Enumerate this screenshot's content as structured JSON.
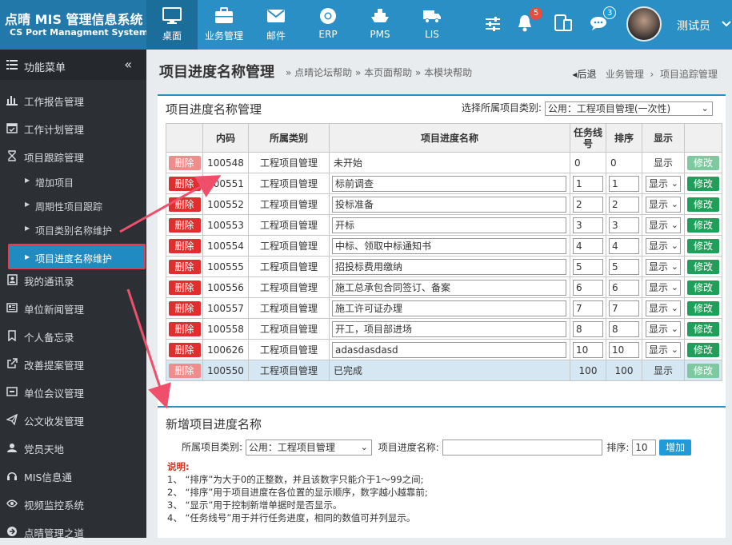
{
  "app": {
    "title": "点晴 MIS 管理信息系统",
    "subtitle": "CS Port Managment System"
  },
  "topnav": [
    {
      "label": "桌面",
      "icon": "monitor-icon",
      "active": true
    },
    {
      "label": "业务管理",
      "icon": "briefcase-icon"
    },
    {
      "label": "邮件",
      "icon": "mail-icon"
    },
    {
      "label": "ERP",
      "icon": "chrome-icon"
    },
    {
      "label": "PMS",
      "icon": "ship-icon"
    },
    {
      "label": "LIS",
      "icon": "truck-icon"
    }
  ],
  "header": {
    "notifications_count": "5",
    "messages_count": "3",
    "user_name": "测试员"
  },
  "sidebar": {
    "title": "功能菜单",
    "items": [
      {
        "label": "工作报告管理",
        "icon": "bar-chart-icon"
      },
      {
        "label": "工作计划管理",
        "icon": "calendar-check-icon"
      },
      {
        "label": "项目跟踪管理",
        "icon": "hourglass-icon"
      },
      {
        "label": "我的通讯录",
        "icon": "address-book-icon"
      },
      {
        "label": "单位新闻管理",
        "icon": "newspaper-icon"
      },
      {
        "label": "个人备忘录",
        "icon": "bookmark-icon"
      },
      {
        "label": "改善提案管理",
        "icon": "external-link-icon"
      },
      {
        "label": "单位会议管理",
        "icon": "meeting-icon"
      },
      {
        "label": "公文收发管理",
        "icon": "paper-plane-icon"
      },
      {
        "label": "党员天地",
        "icon": "user-badge-icon"
      },
      {
        "label": "MIS信息通",
        "icon": "headphones-icon"
      },
      {
        "label": "视频监控系统",
        "icon": "eye-icon"
      },
      {
        "label": "点晴管理之道",
        "icon": "arrow-right-icon"
      }
    ],
    "subitems": [
      {
        "label": "增加项目"
      },
      {
        "label": "周期性项目跟踪"
      },
      {
        "label": "项目类别名称维护"
      },
      {
        "label": "项目进度名称维护",
        "active": true
      }
    ]
  },
  "page": {
    "title": "项目进度名称管理",
    "help_links": [
      "» 点晴论坛帮助",
      "» 本页面帮助",
      "» 本模块帮助"
    ],
    "breadcrumb": {
      "back": "◂后退",
      "level1": "业务管理",
      "level2": "项目追踪管理"
    }
  },
  "list_panel": {
    "title": "项目进度名称管理",
    "filter_label": "选择所属项目类别:",
    "filter_value": "公用：工程项目管理(一次性)",
    "columns": [
      "",
      "内码",
      "所属类别",
      "项目进度名称",
      "任务线号",
      "排序",
      "显示",
      ""
    ],
    "delete_label": "删除",
    "modify_label": "修改",
    "rows": [
      {
        "code": "100548",
        "category": "工程项目管理",
        "name": "未开始",
        "task": "0",
        "order": "0",
        "show": "显示",
        "editable": false
      },
      {
        "code": "100551",
        "category": "工程项目管理",
        "name": "标前调查",
        "task": "1",
        "order": "1",
        "show": "显示",
        "editable": true
      },
      {
        "code": "100552",
        "category": "工程项目管理",
        "name": "投标准备",
        "task": "2",
        "order": "2",
        "show": "显示",
        "editable": true
      },
      {
        "code": "100553",
        "category": "工程项目管理",
        "name": "开标",
        "task": "3",
        "order": "3",
        "show": "显示",
        "editable": true
      },
      {
        "code": "100554",
        "category": "工程项目管理",
        "name": "中标、领取中标通知书",
        "task": "4",
        "order": "4",
        "show": "显示",
        "editable": true
      },
      {
        "code": "100555",
        "category": "工程项目管理",
        "name": "招投标费用缴纳",
        "task": "5",
        "order": "5",
        "show": "显示",
        "editable": true
      },
      {
        "code": "100556",
        "category": "工程项目管理",
        "name": "施工总承包合同签订、备案",
        "task": "6",
        "order": "6",
        "show": "显示",
        "editable": true
      },
      {
        "code": "100557",
        "category": "工程项目管理",
        "name": "施工许可证办理",
        "task": "7",
        "order": "7",
        "show": "显示",
        "editable": true
      },
      {
        "code": "100558",
        "category": "工程项目管理",
        "name": "开工，项目部进场",
        "task": "8",
        "order": "8",
        "show": "显示",
        "editable": true
      },
      {
        "code": "100626",
        "category": "工程项目管理",
        "name": "adasdasdasd",
        "task": "10",
        "order": "10",
        "show": "显示",
        "editable": true
      },
      {
        "code": "100550",
        "category": "工程项目管理",
        "name": "已完成",
        "task": "100",
        "order": "100",
        "show": "显示",
        "editable": false
      }
    ]
  },
  "add_panel": {
    "title": "新增项目进度名称",
    "category_label": "所属项目类别:",
    "category_value": "公用：工程项目管理",
    "name_label": "项目进度名称:",
    "name_value": "",
    "order_label": "排序:",
    "order_value": "10",
    "add_label": "增加",
    "notes_title": "说明:",
    "notes": [
      "1、 “排序”为大于0的正整数，并且该数字只能介于1～99之间;",
      "2、 “排序”用于项目进度在各位置的显示顺序，数字越小越靠前;",
      "3、 “显示”用于控制新增单据时是否显示。",
      "4、 “任务线号”用于并行任务进度，相同的数值可并列显示。"
    ]
  },
  "colors": {
    "topbar": "#2a8fc4",
    "sidebar": "#2c3035",
    "delete": "#e02e2e",
    "modify": "#1fa05a",
    "highlight_border": "#e83e4a"
  }
}
